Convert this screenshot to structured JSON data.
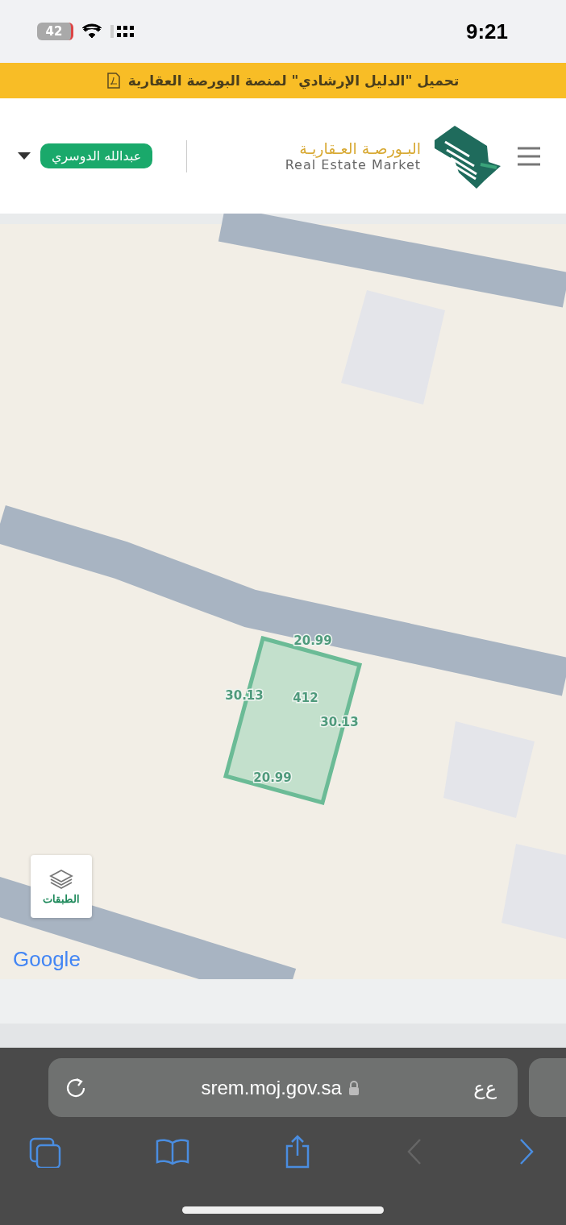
{
  "status_bar": {
    "time": "9:21",
    "battery": "42"
  },
  "banner": {
    "text": "تحميل \"الدليل الإرشادي\" لمنصة البورصة العقارية"
  },
  "header": {
    "logo_arabic": "البـورصـة العـقاريـة",
    "logo_english": "Real Estate Market",
    "user_name": "عبدالله الدوسري"
  },
  "map": {
    "parcel": {
      "number": "412",
      "sides": [
        "20.99",
        "30.13",
        "20.99",
        "30.13"
      ]
    },
    "layers_button": "الطبقات",
    "attribution": "Google"
  },
  "browser": {
    "url": "srem.moj.gov.sa",
    "reader_label": "ﻉﻉ",
    "back_disabled": true,
    "forward_disabled": false
  }
}
